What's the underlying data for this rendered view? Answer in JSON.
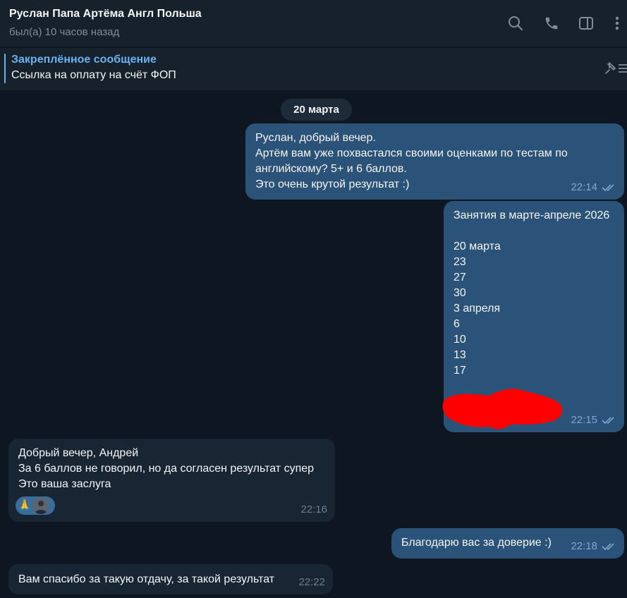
{
  "header": {
    "title": "Руслан Папа Артёма Англ Польша",
    "status": "был(а) 10 часов назад",
    "icons": [
      "search-icon",
      "phone-icon",
      "sidebar-toggle-icon",
      "more-vertical-icon"
    ]
  },
  "pinned": {
    "title": "Закреплённое сообщение",
    "text": "Ссылка на оплату на счёт ФОП",
    "icon": "pin-list-icon"
  },
  "date_separator": "20 марта",
  "messages": [
    {
      "direction": "out",
      "lines": [
        "Руслан, добрый вечер.",
        "Артём вам уже похвастался своими оценками по тестам по",
        "английскому? 5+ и 6 баллов.",
        "Это очень крутой результат :)"
      ],
      "time": "22:14",
      "status": "read"
    },
    {
      "direction": "out",
      "lines": [
        "Занятия в марте-апреле 2026",
        "",
        "20 марта",
        "23",
        "27",
        "30",
        "3 апреля",
        "6",
        "10",
        "13",
        "17"
      ],
      "redacted": true,
      "time": "22:15",
      "status": "read"
    },
    {
      "direction": "in",
      "lines": [
        "Добрый вечер, Андрей",
        "За 6 баллов не говорил, но да согласен результат супер",
        "Это ваша заслуга"
      ],
      "reaction": "🙏",
      "time": "22:16"
    },
    {
      "direction": "out",
      "lines": [
        "Благодарю вас за доверие :)"
      ],
      "time": "22:18",
      "status": "read"
    },
    {
      "direction": "in",
      "lines": [
        "Вам спасибо за такую отдачу, за такой результат"
      ],
      "time": "22:22"
    }
  ],
  "colors": {
    "background": "#0e1621",
    "header": "#17212b",
    "outgoing_bubble": "#2b5278",
    "incoming_bubble": "#182533",
    "accent": "#6ab2f2",
    "redaction": "#ff0000"
  }
}
